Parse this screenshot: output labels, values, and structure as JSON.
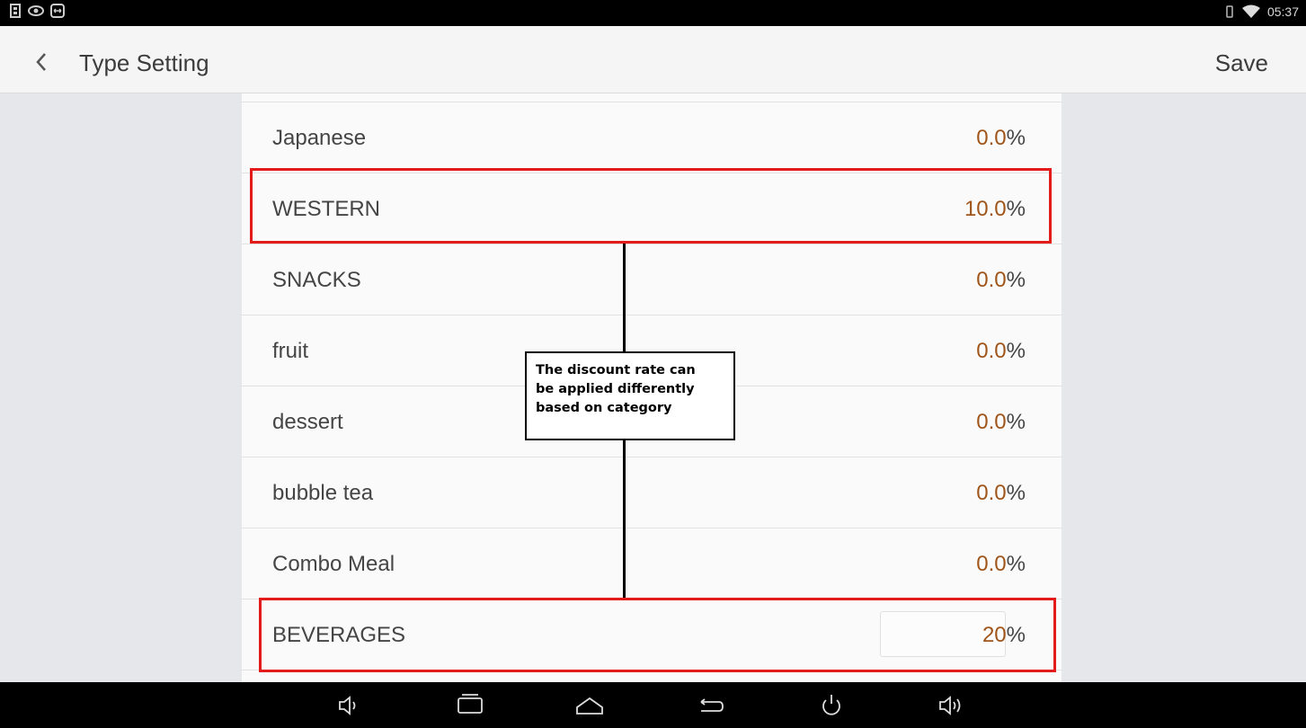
{
  "status_bar": {
    "left_icons": [
      "usb-icon",
      "eye-icon",
      "teamviewer-icon"
    ],
    "right_icons": [
      "vibrate-icon",
      "wifi-icon"
    ],
    "time": "05:37"
  },
  "app_bar": {
    "back_icon": "chevron-left-icon",
    "title": "Type Setting",
    "save_label": "Save"
  },
  "categories": [
    {
      "name": "Japanese",
      "rate": "0.0",
      "unit": "%"
    },
    {
      "name": "WESTERN",
      "rate": "10.0",
      "unit": "%"
    },
    {
      "name": "SNACKS",
      "rate": "0.0",
      "unit": "%"
    },
    {
      "name": "fruit",
      "rate": "0.0",
      "unit": "%"
    },
    {
      "name": "dessert",
      "rate": "0.0",
      "unit": "%"
    },
    {
      "name": "bubble tea",
      "rate": "0.0",
      "unit": "%"
    },
    {
      "name": "Combo Meal",
      "rate": "0.0",
      "unit": "%"
    },
    {
      "name": "BEVERAGES",
      "rate": "20",
      "unit": "%"
    }
  ],
  "annotation": {
    "lines": [
      "The discount rate can",
      "be applied differently",
      "based on category"
    ],
    "highlight_color": "#e31b1b"
  },
  "colors": {
    "rate_value": "#a0561b",
    "appbar_bg": "#f5f5f5",
    "list_bg": "#fafafa"
  },
  "nav_bar": {
    "icons": [
      "volume-down-icon",
      "recent-apps-icon",
      "home-icon",
      "back-arrow-icon",
      "power-icon",
      "volume-up-icon"
    ]
  }
}
